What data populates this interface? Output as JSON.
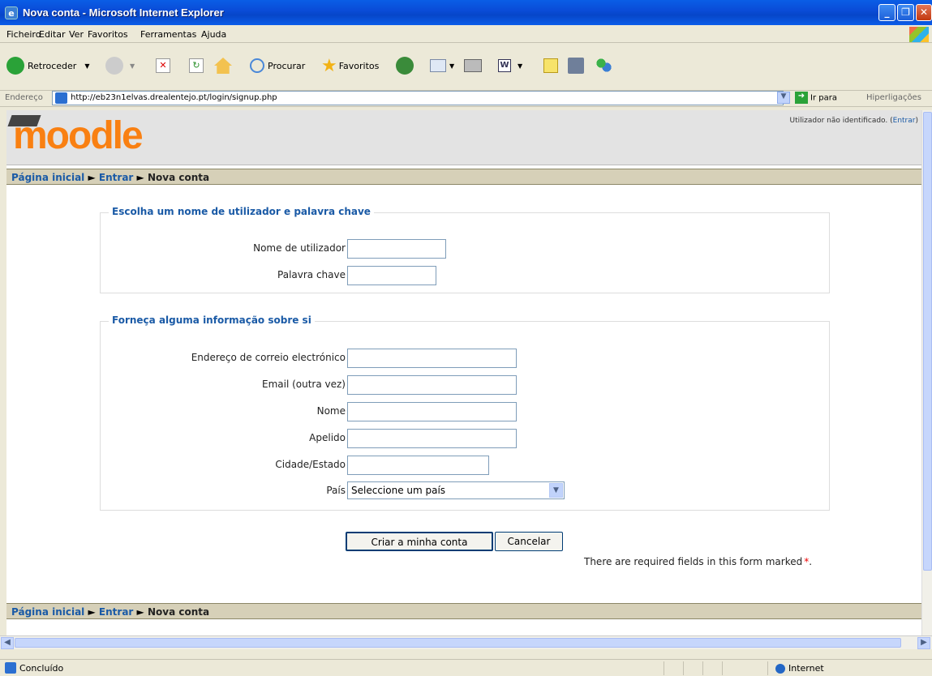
{
  "window": {
    "title": "Nova conta - Microsoft Internet Explorer"
  },
  "menu": [
    "Ficheiro",
    "Editar",
    "Ver",
    "Favoritos",
    "Ferramentas",
    "Ajuda"
  ],
  "toolbar": {
    "back_label": "Retroceder",
    "search_label": "Procurar",
    "favorites_label": "Favoritos"
  },
  "address": {
    "label": "Endereço",
    "url": "http://eb23n1elvas.drealentejo.pt/login/signup.php",
    "go_label": "Ir para",
    "links_label": "Hiperligações"
  },
  "header": {
    "logo": "moodle",
    "user_status": "Utilizador não identificado.",
    "login_link": "Entrar"
  },
  "breadcrumb": {
    "home": "Página inicial",
    "sep": "►",
    "login": "Entrar",
    "current": "Nova conta"
  },
  "section1": {
    "legend": "Escolha um nome de utilizador e palavra chave",
    "fields": [
      {
        "label": "Nome de utilizador",
        "value": ""
      },
      {
        "label": "Palavra chave",
        "value": ""
      }
    ]
  },
  "section2": {
    "legend": "Forneça alguma informação sobre si",
    "fields": [
      {
        "label": "Endereço de correio electrónico",
        "value": ""
      },
      {
        "label": "Email (outra vez)",
        "value": ""
      },
      {
        "label": "Nome",
        "value": ""
      },
      {
        "label": "Apelido",
        "value": ""
      },
      {
        "label": "Cidade/Estado",
        "value": ""
      }
    ],
    "country": {
      "label": "País",
      "selected": "Seleccione um país"
    }
  },
  "required_marker": "*",
  "buttons": {
    "submit": "Criar a minha conta",
    "cancel": "Cancelar"
  },
  "required_note": "There are required fields in this form marked",
  "status": {
    "text": "Concluído",
    "zone": "Internet"
  }
}
